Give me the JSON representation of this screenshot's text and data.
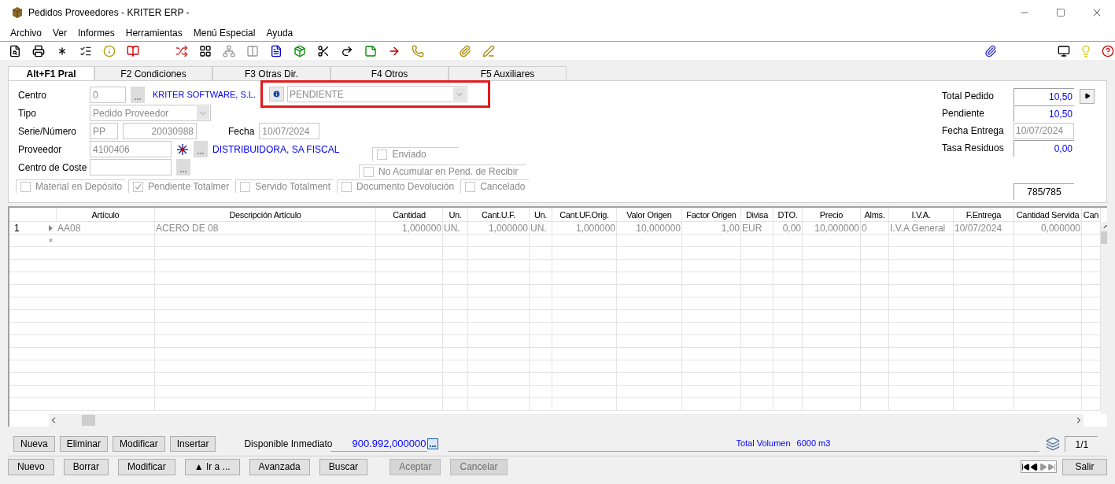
{
  "window": {
    "title": "Pedidos Proveedores - KRITER ERP -"
  },
  "menu": [
    "Archivo",
    "Ver",
    "Informes",
    "Herramientas",
    "Menú Especial",
    "Ayuda"
  ],
  "tabs": [
    {
      "label": "Alt+F1 Pral",
      "selected": true
    },
    {
      "label": "F2 Condiciones",
      "selected": false
    },
    {
      "label": "F3 Otras Dir.",
      "selected": false
    },
    {
      "label": "F4 Otros",
      "selected": false
    },
    {
      "label": "F5 Auxiliares",
      "selected": false
    }
  ],
  "form": {
    "centro": {
      "label": "Centro",
      "value": "0",
      "name": "KRITER SOFTWARE, S.L."
    },
    "estado": {
      "value": "PENDIENTE"
    },
    "tipo": {
      "label": "Tipo",
      "value": "Pedido Proveedor"
    },
    "serie": {
      "label": "Serie/Número",
      "serie": "PP",
      "numero": "20030988"
    },
    "fecha": {
      "label": "Fecha",
      "value": "10/07/2024"
    },
    "proveedor": {
      "label": "Proveedor",
      "value": "4100406",
      "name": "DISTRIBUIDORA, SA FISCAL"
    },
    "centro_coste": {
      "label": "Centro de Coste"
    },
    "flags": [
      {
        "label": "Enviado",
        "checked": false
      },
      {
        "label": "No Acumular en Pend. de Recibir",
        "checked": false
      }
    ],
    "options": [
      {
        "label": "Material en Depósito",
        "checked": false
      },
      {
        "label": "Pendiente Totalmer",
        "checked": true
      },
      {
        "label": "Servido Totalment",
        "checked": false
      },
      {
        "label": "Documento Devolución",
        "checked": false
      },
      {
        "label": "Cancelado",
        "checked": false
      }
    ],
    "totals": [
      {
        "label": "Total Pedido",
        "value": "10,50",
        "kind": "amount"
      },
      {
        "label": "Pendiente",
        "value": "10,50",
        "kind": "amount"
      },
      {
        "label": "Fecha Entrega",
        "value": "10/07/2024",
        "kind": "date"
      },
      {
        "label": "Tasa Residuos",
        "value": "0,00",
        "kind": "amount"
      }
    ],
    "counter": "785/785"
  },
  "grid": {
    "columns": [
      "Artículo",
      "Descripción Artículo",
      "Cantidad",
      "Un.",
      "Cant.U.F.",
      "Un.",
      "Cant.UF.Orig.",
      "Valor Origen",
      "Factor Origen",
      "Divisa",
      "DTO.",
      "Precio",
      "Alms.",
      "I.V.A.",
      "F.Entrega",
      "Cantidad Servida",
      "Can"
    ],
    "rows": [
      {
        "number": "1",
        "cells": [
          "AA08",
          "ACERO DE 08",
          "1,000000",
          "UN.",
          "1,000000",
          "UN.",
          "1,000000",
          "10,000000",
          "1,00",
          "EUR",
          "0,00",
          "10,000000",
          "0",
          "I.V.A General",
          "10/07/2024",
          "0,000000",
          ""
        ]
      }
    ]
  },
  "line_buttons": [
    "Nueva",
    "Eliminar",
    "Modificar",
    "Insertar"
  ],
  "disponible": {
    "label": "Disponible Inmediato",
    "value": "900.992,000000"
  },
  "volumen": {
    "label": "Total Volumen",
    "value": "6000 m3"
  },
  "page": "1/1",
  "buttons": [
    {
      "label": "Nuevo",
      "disabled": false
    },
    {
      "label": "Borrar",
      "disabled": false
    },
    {
      "label": "Modificar",
      "disabled": false
    },
    {
      "label": "▲ Ir a ...",
      "disabled": false
    },
    {
      "label": "Avanzada",
      "disabled": false
    },
    {
      "label": "Buscar",
      "disabled": false
    },
    {
      "label": "Aceptar",
      "disabled": true
    },
    {
      "label": "Cancelar",
      "disabled": true
    }
  ],
  "exit": "Salir"
}
